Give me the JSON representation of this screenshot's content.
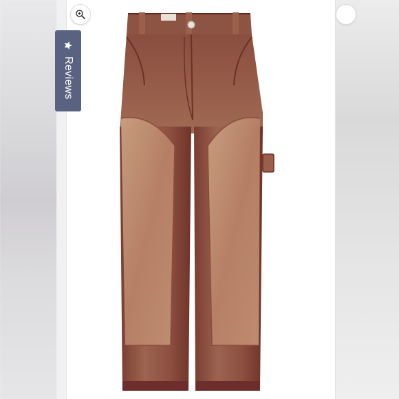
{
  "reviews_tab": {
    "label": "Reviews",
    "icon": "star-icon",
    "color": "#5a6282"
  },
  "zoom_button": {
    "icon": "zoom-in-icon"
  },
  "product": {
    "image": "brown-overdyed-carpenter-pants",
    "colors": {
      "base": "#8f5a45",
      "light_panel": "#c49276",
      "dark_hem": "#6e2f2a"
    }
  }
}
